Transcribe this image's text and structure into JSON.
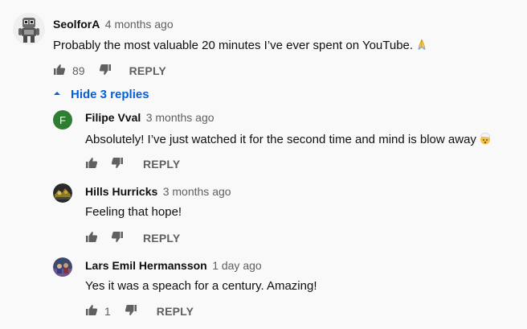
{
  "comment": {
    "author": "SeolforA",
    "time": "4 months ago",
    "text": "Probably the most valuable 20 minutes I’ve ever spent on YouTube.",
    "emoji": "folded-hands",
    "likes": "89",
    "reply_label": "REPLY"
  },
  "toggle": {
    "label": "Hide 3 replies"
  },
  "replies": [
    {
      "avatar_letter": "F",
      "avatar_color": "#2e7d32",
      "author": "Filipe Vval",
      "time": "3 months ago",
      "text": "Absolutely! I’ve just watched it for the second time and mind is blow away",
      "emoji": "exploding-head",
      "likes": "",
      "reply_label": "REPLY"
    },
    {
      "author": "Hills Hurricks",
      "time": "3 months ago",
      "text": "Feeling that hope!",
      "likes": "",
      "reply_label": "REPLY"
    },
    {
      "author": "Lars Emil Hermansson",
      "time": "1 day ago",
      "text": "Yes it was a speach for a century. Amazing!",
      "likes": "1",
      "reply_label": "REPLY"
    }
  ]
}
